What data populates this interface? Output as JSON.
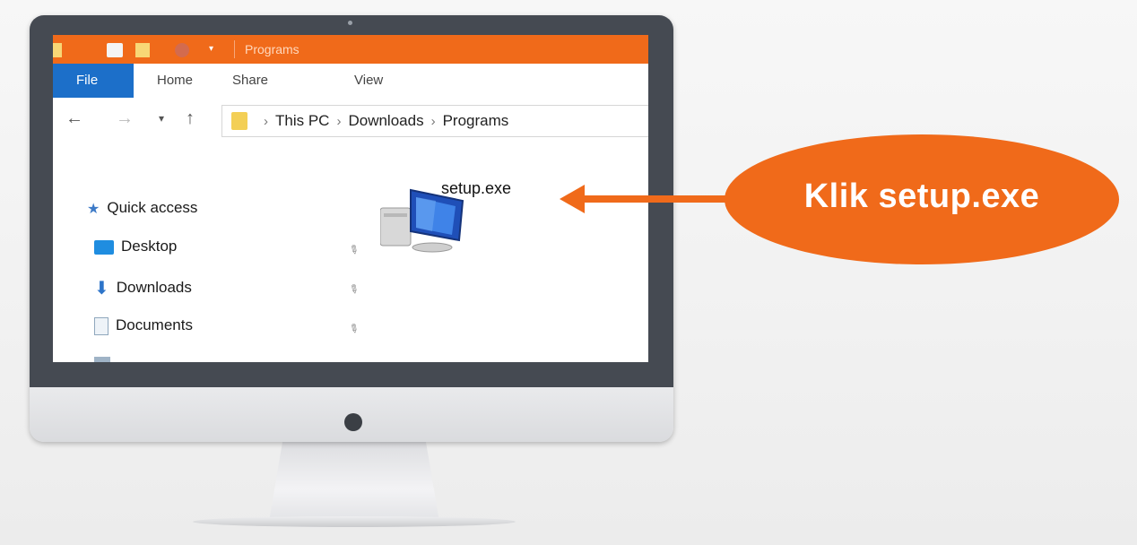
{
  "window": {
    "title": "Programs",
    "accent_color": "#f06a1a",
    "tabs": [
      "File",
      "Home",
      "Share",
      "View"
    ]
  },
  "address": {
    "crumbs": [
      "This PC",
      "Downloads",
      "Programs"
    ]
  },
  "nav_pane": {
    "items": [
      {
        "label": "Quick access",
        "icon": "star-icon"
      },
      {
        "label": "Desktop",
        "icon": "desktop-icon"
      },
      {
        "label": "Downloads",
        "icon": "download-icon"
      },
      {
        "label": "Documents",
        "icon": "documents-icon"
      }
    ]
  },
  "file": {
    "name": "setup.exe",
    "icon": "computer-icon"
  },
  "callout": {
    "text": "Klik setup.exe",
    "color": "#f06a1a"
  }
}
